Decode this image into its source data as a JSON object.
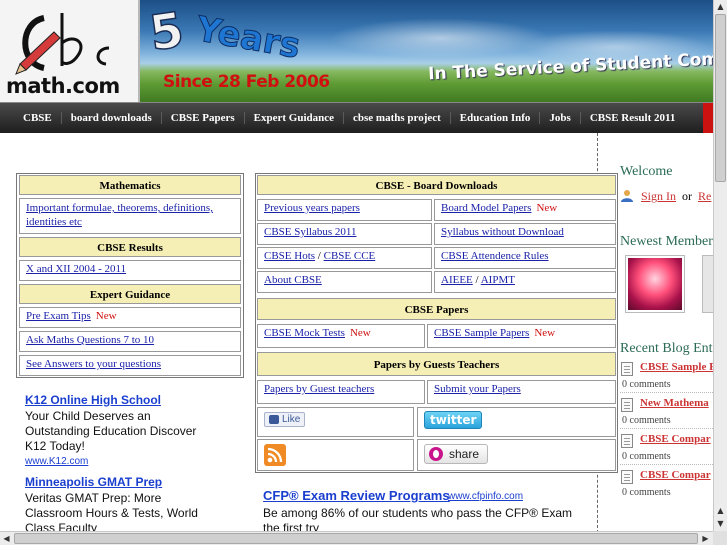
{
  "banner": {
    "logo_text": "math.com",
    "logo_script": "Cbse",
    "years_number": "5",
    "years_word": "Years",
    "since": "Since 28 Feb 2006",
    "tagline": "In The Service of Student Commu"
  },
  "nav": {
    "items": [
      "CBSE",
      "board downloads",
      "CBSE Papers",
      "Expert Guidance",
      "cbse maths project",
      "Education Info",
      "Jobs",
      "CBSE Result 2011"
    ]
  },
  "left": {
    "mathematics": {
      "header": "Mathematics",
      "link": "Important formulae, theorems, definitions, identities etc"
    },
    "results": {
      "header": "CBSE Results",
      "link": "X and XII 2004 - 2011"
    },
    "guidance": {
      "header": "Expert Guidance",
      "links": [
        "Pre Exam Tips",
        "Ask Maths Questions 7 to 10",
        "See Answers to your questions"
      ],
      "new_label": "New"
    }
  },
  "middle": {
    "downloads": {
      "header": "CBSE - Board Downloads",
      "previous_papers": "Previous years papers",
      "board_model_papers": "Board Model Papers",
      "syllabus": "CBSE Syllabus 2011",
      "syllabus_no_download": "Syllabus without Download",
      "hots": "CBSE Hots",
      "cce": "CBSE CCE",
      "attendance": "CBSE Attendence Rules",
      "about": "About CBSE",
      "aieee": "AIEEE",
      "aipmt": "AIPMT",
      "separator": "/",
      "new_label": "New"
    },
    "papers": {
      "header": "CBSE Papers",
      "mock": "CBSE Mock Tests",
      "sample": "CBSE Sample Papers",
      "new_label": "New"
    },
    "guests": {
      "header": "Papers by Guests Teachers",
      "papers_link": "Papers by Guest teachers",
      "submit_link": "Submit your Papers"
    },
    "social": {
      "like": "Like",
      "twitter": "twitter",
      "share": "share"
    }
  },
  "ads": [
    {
      "title": "K12 Online High School",
      "text": "Your Child Deserves an Outstanding Education Discover K12 Today!",
      "url": "www.K12.com"
    },
    {
      "title": "Minneapolis GMAT Prep",
      "text": "Veritas GMAT Prep: More Classroom Hours & Tests, World Class Faculty",
      "url": ""
    },
    {
      "title": "CFP® Exam Review Programs",
      "text": "Be among 86% of our students who pass the CFP® Exam the first try",
      "url": "www.cfpinfo.com"
    }
  ],
  "sidebar": {
    "welcome": "Welcome",
    "sign_in": "Sign In",
    "or": "or",
    "register": "Re",
    "newest_members": "Newest Member",
    "recent_blog": "Recent Blog Ent",
    "posts": [
      {
        "title": "CBSE Sample P",
        "comments": "0 comments"
      },
      {
        "title": "New Mathema",
        "comments": "0 comments"
      },
      {
        "title": "CBSE Compar",
        "comments": "0 comments"
      },
      {
        "title": "CBSE Compar",
        "comments": "0 comments"
      }
    ]
  },
  "colors": {
    "header_bg": "#f5efb6",
    "link": "#1b22a8",
    "new": "#d01010",
    "ad_link": "#1a3fcf",
    "sidebar_heading": "#2b6b55",
    "sidebar_link": "#cc3333"
  }
}
